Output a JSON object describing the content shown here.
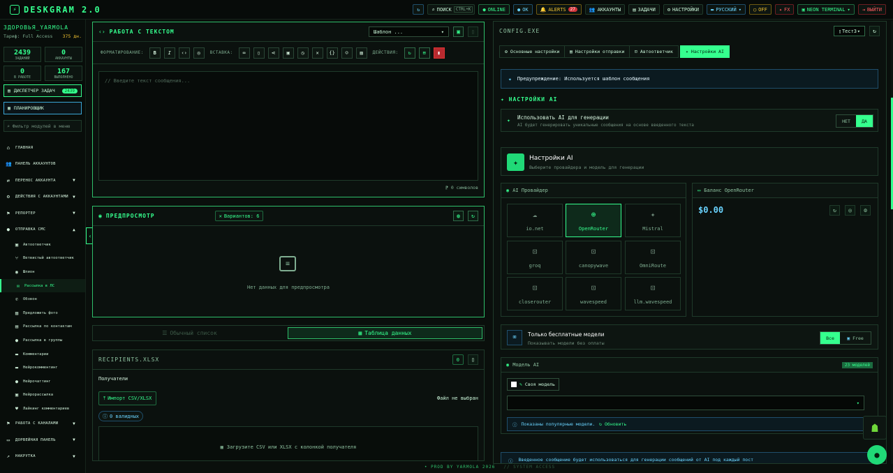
{
  "topbar": {
    "logo": "DESKGRAM 2.0",
    "search_label": "ПОИСК",
    "search_kbd": "CTRL+K",
    "online": "ONLINE",
    "ok": "OK",
    "alerts": "ALERTS",
    "alerts_count": "27",
    "accounts": "АККАУНТЫ",
    "tasks": "ЗАДАЧИ",
    "settings": "НАСТРОЙКИ",
    "language": "РУССКИЙ",
    "off": "OFF",
    "fx": "FX",
    "theme": "NEON TERMINAL",
    "logout": "ВЫЙТИ"
  },
  "sidebar": {
    "user_name": "ЗДОРОВЬЯ_YARMOLA",
    "plan": "Тариф: Full Access",
    "balance": "375 дн.",
    "stats": [
      {
        "value": "2439",
        "label": "ЗАДАНИЙ"
      },
      {
        "value": "0",
        "label": "АККАУНТЫ"
      },
      {
        "value": "0",
        "label": "В РАБОТЕ"
      },
      {
        "value": "167",
        "label": "ВЫПОЛНЕНО"
      }
    ],
    "dispatcher_label": "ДИСПЕТЧЕР ЗАДАЧ",
    "dispatcher_count": "2439",
    "planner_label": "ПЛАНИРОВЩИК",
    "filter_placeholder": "Фильтр модулей в меню",
    "menu": [
      {
        "label": "ГЛАВНАЯ",
        "icon": "home-icon"
      },
      {
        "label": "ПАНЕЛЬ АККАУНТОВ",
        "icon": "users-icon"
      },
      {
        "label": "ПЕРЕНОС АККАУНТА",
        "icon": "transfer-icon"
      },
      {
        "label": "ДЕЙСТВИЯ С АККАУНТАМИ",
        "icon": "users-cog-icon"
      },
      {
        "label": "РЕПОРТЕР",
        "icon": "flag-icon"
      },
      {
        "label": "ОТПРАВКА СМС",
        "icon": "chat-icon"
      }
    ],
    "submenu": [
      "Автоответчик",
      "Ветвистый автоответчик",
      "Шпион",
      "Рассылка в ЛС",
      "Обзвон",
      "Предложить фото",
      "Рассылка по контактам",
      "Рассылка в группы",
      "Комментарии",
      "Нейрокомментинг",
      "Нейрочаттинг",
      "Нейрорассылка",
      "Лайкинг комментариев"
    ],
    "menu_bottom": [
      {
        "label": "РАБОТА С КАНАЛАМИ",
        "icon": "flag-icon"
      },
      {
        "label": "ДОРВЕЙНАЯ ПАНЕЛЬ",
        "icon": "layout-icon"
      },
      {
        "label": "НАКРУТКА",
        "icon": "chart-icon"
      }
    ]
  },
  "text_panel": {
    "title": "РАБОТА С ТЕКСТОМ",
    "template_select": "Шаблон ...",
    "format_label": "ФОРМАТИРОВАНИЕ:",
    "insert_label": "ВСТАВКА:",
    "actions_label": "ДЕЙСТВИЯ:",
    "placeholder": "// Введите текст сообщения...",
    "char_count": "0 символов"
  },
  "preview_panel": {
    "title": "ПРЕДПРОСМОТР",
    "variants": "Вариантов: 6",
    "empty": "Нет данных для предпросмотра"
  },
  "list_tabs": {
    "simple": "Обычный список",
    "table": "Таблица данных"
  },
  "recipients_panel": {
    "title": "RECIPIENTS.XLSX",
    "count": "0",
    "section": "Получатели",
    "import_label": "Импорт CSV/XLSX",
    "no_file": "Файл не выбран",
    "valid": "0 валидных",
    "upload_hint": "Загрузите CSV или XLSX с колонкой получателя"
  },
  "config": {
    "title": "CONFIG.EXE",
    "preset": "Тест3",
    "tabs": [
      "Основные настройки",
      "Настройки отправки",
      "Автоответчик",
      "Настройки AI"
    ],
    "warning": "Предупреждение: Используется шаблон сообщения",
    "ai_section": "НАСТРОЙКИ AI",
    "use_ai_title": "Использовать AI для генерации",
    "use_ai_desc": "AI будет генерировать уникальные сообщения на основе введенного текста",
    "no": "НЕТ",
    "yes": "ДА",
    "ai_settings_title": "Настройки AI",
    "ai_settings_desc": "Выберите провайдера и модель для генерации",
    "provider_title": "AI Провайдер",
    "providers": [
      "io.net",
      "OpenRouter",
      "Mistral",
      "groq",
      "canopywave",
      "OmniRoute",
      "closerouter",
      "wavespeed",
      "llm.wavespeed"
    ],
    "balance_title": "Баланс OpenRouter",
    "balance_value": "$0.00",
    "free_title": "Только бесплатные модели",
    "free_desc": "Показывать модели без оплаты",
    "all": "Все",
    "free": "Free",
    "model_title": "Модель AI",
    "model_count": "23 моделей",
    "own_model": "Своя модель",
    "popular_info": "Показаны популярные модели.",
    "refresh": "Обновить",
    "bottom_info": "Введенное сообщение будет использоваться для генерации сообщений от AI под каждый пост"
  },
  "footer": {
    "left": "• PROD BY YARMOLA 2026",
    "right": "// SYSTEM ACCESS"
  }
}
